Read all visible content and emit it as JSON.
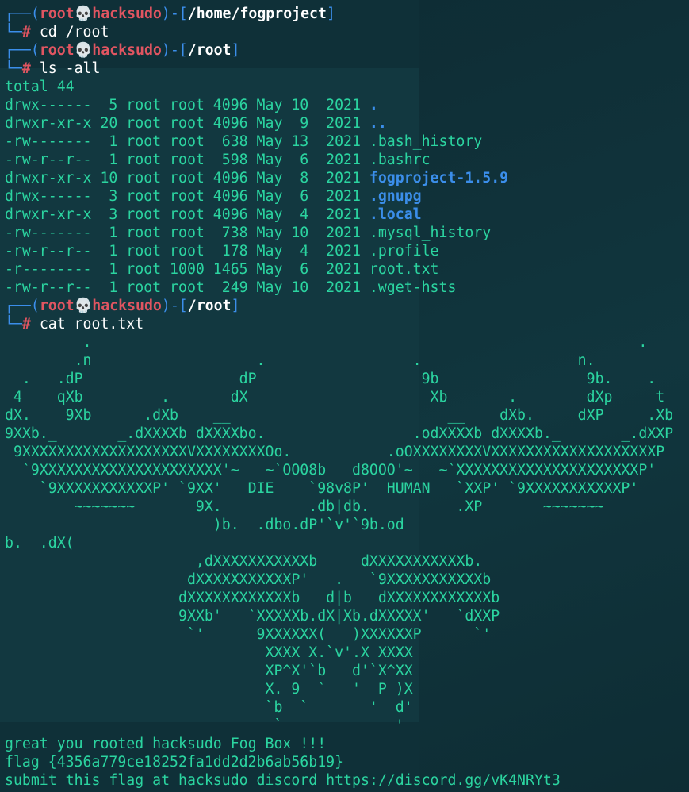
{
  "prompts": [
    {
      "user": "root",
      "skull": "💀",
      "host": "hacksudo",
      "path": "/home/fogproject",
      "command": "cd /root"
    },
    {
      "user": "root",
      "skull": "💀",
      "host": "hacksudo",
      "path": "/root",
      "command": "ls -all"
    },
    {
      "user": "root",
      "skull": "💀",
      "host": "hacksudo",
      "path": "/root",
      "command": "cat root.txt"
    }
  ],
  "ls_total": "total 44",
  "ls_rows": [
    {
      "meta": "drwx------  5 root root 4096 May 10  2021 ",
      "name": "."
    },
    {
      "meta": "drwxr-xr-x 20 root root 4096 May  9  2021 ",
      "name": ".."
    },
    {
      "meta": "-rw-------  1 root root  638 May 13  2021 ",
      "name": ".bash_history"
    },
    {
      "meta": "-rw-r--r--  1 root root  598 May  6  2021 ",
      "name": ".bashrc"
    },
    {
      "meta": "drwxr-xr-x 10 root root 4096 May  8  2021 ",
      "name": "fogproject-1.5.9"
    },
    {
      "meta": "drwx------  3 root root 4096 May  6  2021 ",
      "name": ".gnupg"
    },
    {
      "meta": "drwxr-xr-x  3 root root 4096 May  4  2021 ",
      "name": ".local"
    },
    {
      "meta": "-rw-------  1 root root  738 May 10  2021 ",
      "name": ".mysql_history"
    },
    {
      "meta": "-rw-r--r--  1 root root  178 May  4  2021 ",
      "name": ".profile"
    },
    {
      "meta": "-r--------  1 root 1000 1465 May  6  2021 ",
      "name": "root.txt"
    },
    {
      "meta": "-rw-r--r--  1 root root  249 May 10  2021 ",
      "name": ".wget-hsts"
    }
  ],
  "art": [
    "         .                                                               .",
    "        .n                   .                 .                  n.",
    "  .   .dP                  dP                   9b                 9b.    .",
    " 4    qXb         .       dX                     Xb       .        dXp     t",
    "dX.    9Xb      .dXb    __                         __    dXb.     dXP     .Xb",
    "9XXb._       _.dXXXXb dXXXXbo.                 .odXXXXb dXXXXb._       _.dXXP",
    " 9XXXXXXXXXXXXXXXXXXXVXXXXXXXXOo.           .oOXXXXXXXXVXXXXXXXXXXXXXXXXXXXP",
    "  `9XXXXXXXXXXXXXXXXXXXXX'~   ~`OO08b   d8OOO'~   ~`XXXXXXXXXXXXXXXXXXXXXP'",
    "    `9XXXXXXXXXXXP' `9XX'   DIE    `98v8P'  HUMAN   `XXP' `9XXXXXXXXXXXP'",
    "        ~~~~~~~       9X.          .db|db.          .XP       ~~~~~~~",
    "                        )b.  .dbo.dP'`v'`9b.od",
    "b.  .dX(",
    "                      ,dXXXXXXXXXXXb     dXXXXXXXXXXXb.",
    "                     dXXXXXXXXXXXP'   .   `9XXXXXXXXXXXb",
    "                    dXXXXXXXXXXXXb   d|b   dXXXXXXXXXXXXb",
    "                    9XXb'   `XXXXXb.dX|Xb.dXXXXX'   `dXXP",
    "                     `'      9XXXXXX(   )XXXXXXP      `'",
    "                              XXXX X.`v'.X XXXX",
    "                              XP^X'`b   d'`X^XX",
    "                              X. 9  `   '  P )X",
    "                              `b  `       '  d'",
    "                               `             '"
  ],
  "footer": [
    "great you rooted hacksudo Fog Box !!!",
    "flag {4356a779ce18252fa1dd2d2b6ab56b19}",
    "submit this flag at hacksudo discord https://discord.gg/vK4NRYt3"
  ],
  "colors": {
    "background": "#0f3038",
    "text": "#2bd4a0",
    "user": "#e05561",
    "dir": "#3b8eea"
  }
}
